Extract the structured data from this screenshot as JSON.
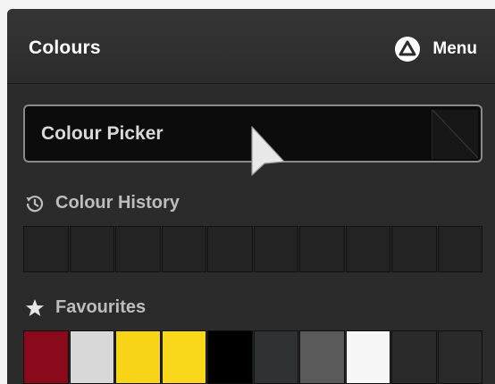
{
  "header": {
    "title": "Colours",
    "menu_label": "Menu",
    "menu_icon": "triangle-in-circle-icon"
  },
  "picker": {
    "label": "Colour Picker",
    "current_color": "#171717"
  },
  "history": {
    "label": "Colour History",
    "icon": "clock-history-icon",
    "swatches": [
      "#232323",
      "#232323",
      "#232323",
      "#232323",
      "#232323",
      "#232323",
      "#232323",
      "#232323",
      "#232323",
      "#232323"
    ]
  },
  "favourites": {
    "label": "Favourites",
    "icon": "star-icon",
    "swatches": [
      "#8a0a1c",
      "#d8d8d8",
      "#f7d516",
      "#f9d81a",
      "#000000",
      "#2f3232",
      "#5a5a5a",
      "#f6f6f6",
      "#2a2a2a",
      "#2a2a2a"
    ]
  }
}
